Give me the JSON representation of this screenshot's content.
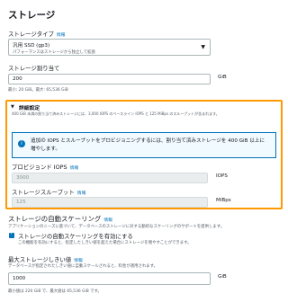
{
  "section": {
    "title": "ストレージ"
  },
  "storage_type": {
    "label": "ストレージタイプ",
    "info": "情報",
    "value": "汎用 SSD (gp3)",
    "description": "パフォーマンスはストレージから独立して拡張"
  },
  "allocated": {
    "label": "ストレージ割り当て",
    "value": "200",
    "unit": "GiB",
    "hint": "最小: 20 GiB。最大: 65,536 GiB"
  },
  "advanced": {
    "title": "詳細設定",
    "description": "400 GiB 未満の割り当て済みストレージには、3,000 IOPS のベースライン IOPS と 125 MiBps のスループットが含まれます。",
    "note": "追加の IOPS とスループットをプロビジョニングするには、割り当て済みストレージを 400 GiB 以上に増やします。"
  },
  "iops": {
    "label": "プロビジョンド IOPS",
    "info": "情報",
    "value": "3000",
    "unit": "IOPS"
  },
  "throughput": {
    "label": "ストレージスループット",
    "info": "情報",
    "value": "125",
    "unit": "MiBps"
  },
  "autoscaling": {
    "title": "ストレージの自動スケーリング",
    "info": "情報",
    "description": "アプリケーションのニーズに基づいて、データベースのストレージに対する動的なスケーリングのサポートを提供します。",
    "checkbox_label": "ストレージの自動スケーリングを有効にする",
    "checkbox_desc": "この機能を有効にすると、指定したしきい値を超えた場合にストレージを増やすことができます。",
    "max_label": "最大ストレージしきい値",
    "max_info": "情報",
    "max_desc": "データベースが指定されたしきい値に自動スケールされると、料金が適用されます。",
    "max_value": "1000",
    "max_unit": "GiB",
    "max_hint": "最小値は 220 GiB で、最大値は 65,536 GiB です。"
  },
  "colors": {
    "accent": "#0073bb",
    "highlight": "#ff9900"
  }
}
